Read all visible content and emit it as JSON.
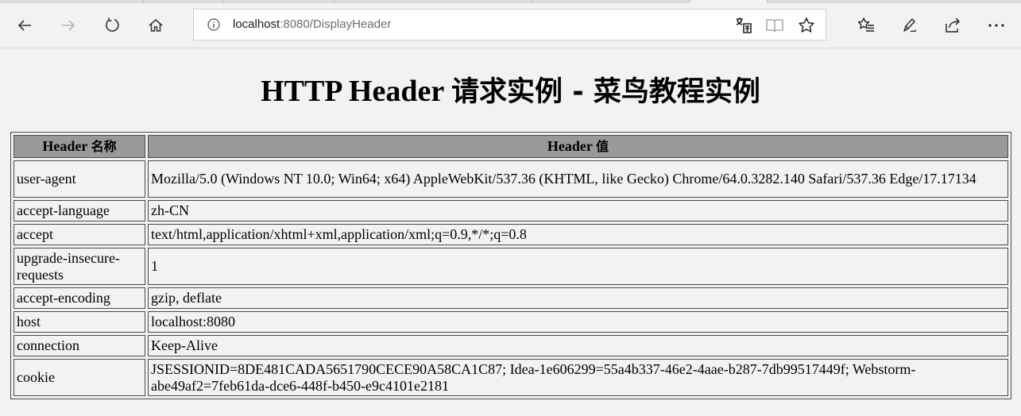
{
  "browser": {
    "url_host": "localhost",
    "url_rest": ":8080/DisplayHeader",
    "icons": [
      "back-icon",
      "forward-icon",
      "refresh-icon",
      "home-icon",
      "info-icon",
      "translate-icon",
      "reading-view-icon",
      "favorite-star-icon",
      "favorites-list-icon",
      "pen-icon",
      "share-icon",
      "more-icon"
    ]
  },
  "page": {
    "title_latin": "HTTP Header ",
    "title_cjk": "请求实例 - 菜鸟教程实例"
  },
  "table": {
    "col1_latin": "Header ",
    "col1_cjk": "名称",
    "col2_latin": "Header ",
    "col2_cjk": "值",
    "rows": [
      {
        "name": "user-agent",
        "value": "Mozilla/5.0 (Windows NT 10.0; Win64; x64) AppleWebKit/537.36 (KHTML, like Gecko) Chrome/64.0.3282.140 Safari/537.36 Edge/17.17134"
      },
      {
        "name": "accept-language",
        "value": "zh-CN"
      },
      {
        "name": "accept",
        "value": "text/html,application/xhtml+xml,application/xml;q=0.9,*/*;q=0.8"
      },
      {
        "name": "upgrade-insecure-requests",
        "value": "1"
      },
      {
        "name": "accept-encoding",
        "value": "gzip, deflate"
      },
      {
        "name": "host",
        "value": "localhost:8080"
      },
      {
        "name": "connection",
        "value": "Keep-Alive"
      },
      {
        "name": "cookie",
        "value": "JSESSIONID=8DE481CADA5651790CECE90A58CA1C87; Idea-1e606299=55a4b337-46e2-4aae-b287-7db99517449f; Webstorm-abe49af2=7feb61da-dce6-448f-b450-e9c4101e2181"
      }
    ]
  }
}
